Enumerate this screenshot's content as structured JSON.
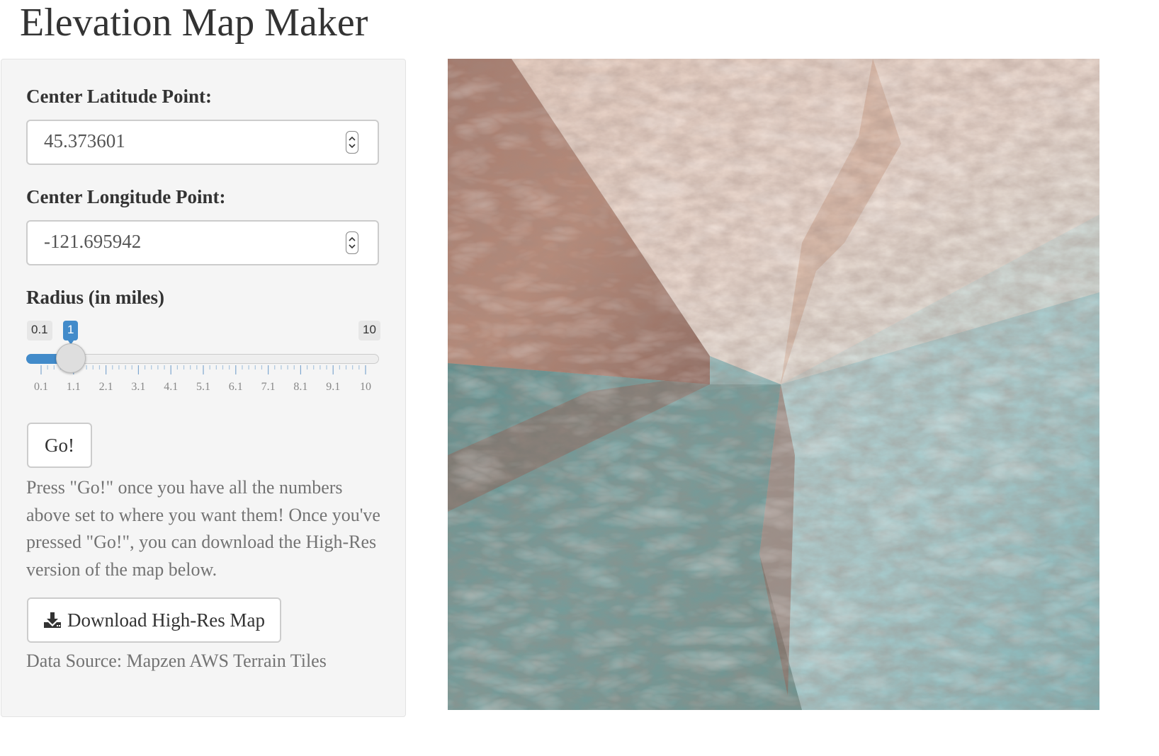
{
  "page": {
    "title": "Elevation Map Maker"
  },
  "sidebar": {
    "latitude": {
      "label": "Center Latitude Point:",
      "value": "45.373601"
    },
    "longitude": {
      "label": "Center Longitude Point:",
      "value": "-121.695942"
    },
    "radius": {
      "label": "Radius (in miles)",
      "min_label": "0.1",
      "max_label": "10",
      "current_label": "1",
      "min": 0.1,
      "max": 10,
      "value": 1,
      "grid_labels": [
        "0.1",
        "1.1",
        "2.1",
        "3.1",
        "4.1",
        "5.1",
        "6.1",
        "7.1",
        "8.1",
        "9.1",
        "10"
      ]
    },
    "go_button": {
      "label": "Go!"
    },
    "help_text": "Press \"Go!\" once you have all the numbers above set to where you want them! Once you've pressed \"Go!\", you can download the High-Res version of the map below.",
    "download_button": {
      "icon": "download-icon",
      "label": "Download High-Res Map"
    },
    "data_source": "Data Source: Mapzen AWS Terrain Tiles"
  },
  "map": {
    "description_icon": "elevation-map-image",
    "colors": {
      "warm": "#c99a86",
      "cool": "#6aa3a6",
      "light": "#e9d8cf",
      "dark": "#7a5548"
    }
  },
  "theme": {
    "accent": "#428bca",
    "panel_bg": "#f5f5f5"
  }
}
